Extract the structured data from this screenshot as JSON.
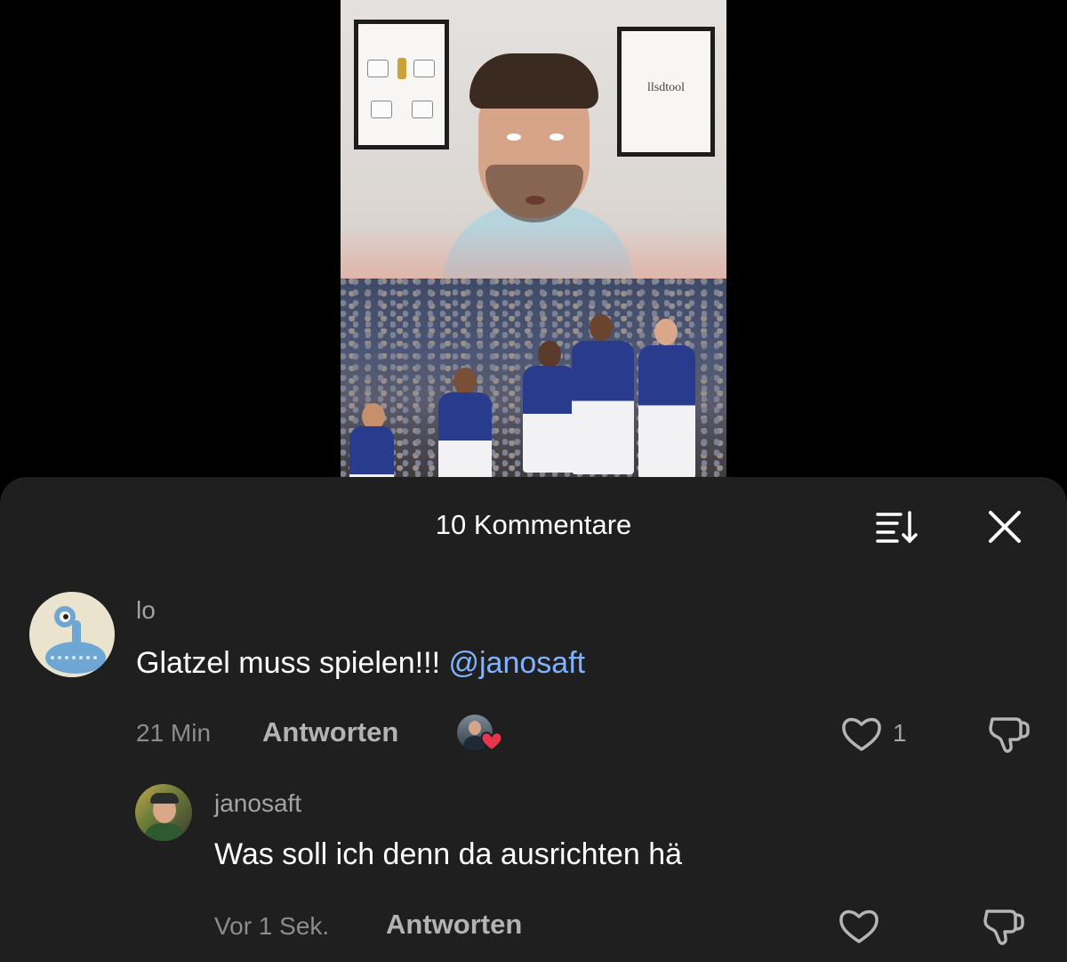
{
  "sheet": {
    "title": "10 Kommentare",
    "sort_icon": "sort-icon",
    "close_icon": "close-icon"
  },
  "video": {
    "poster_right_text": "llsdtool"
  },
  "comments": [
    {
      "username": "lo",
      "text": "Glatzel muss spielen!!!",
      "mention": "@janosaft",
      "time": "21 Min",
      "reply_label": "Antworten",
      "likes": "1",
      "avatar_icon": "alien-avatar-icon"
    },
    {
      "username": "janosaft",
      "text": "Was soll ich denn da ausrichten hä",
      "time": "Vor 1 Sek.",
      "reply_label": "Antworten",
      "avatar_icon": "user-photo-avatar"
    }
  ],
  "colors": {
    "sheet_bg": "#1f1f1f",
    "mention": "#7fb3ff",
    "heart_red": "#e8364f",
    "muted_text": "#8c8c8c"
  }
}
